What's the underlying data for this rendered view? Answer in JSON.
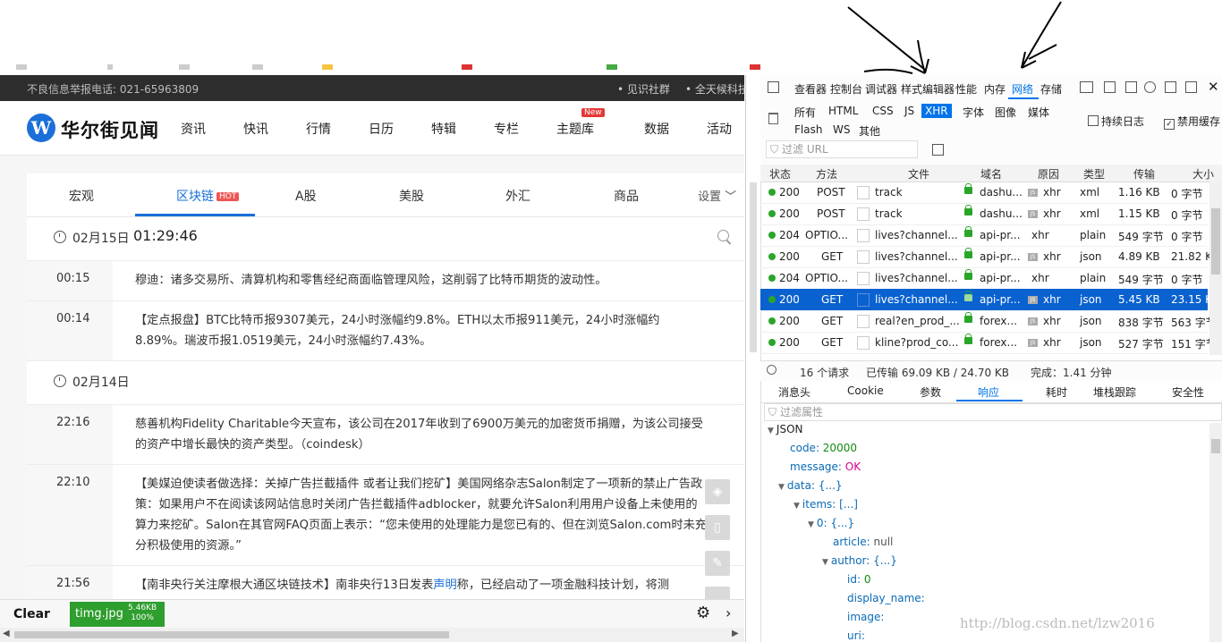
{
  "website": {
    "topbar": {
      "report": "不良信息举报电话: 021-65963809",
      "link1": "• 见识社群",
      "link2": "• 全天候科技"
    },
    "logo": {
      "mark": "W",
      "name": "华尔街见闻"
    },
    "nav": [
      "资讯",
      "快讯",
      "行情",
      "日历",
      "特辑",
      "专栏",
      "主题库",
      "数据",
      "活动"
    ],
    "nav_badge": "New",
    "tabs": [
      "宏观",
      "区块链",
      "A股",
      "美股",
      "外汇",
      "商品"
    ],
    "active_tab": "区块链",
    "hot_badge": "HOT",
    "settings_label": "设置 ﹀",
    "day1": {
      "date": "02月15日",
      "time": "01:29:46"
    },
    "day2": {
      "date": "02月14日"
    },
    "news": [
      {
        "time": "00:15",
        "text": "穆迪：诸多交易所、清算机构和零售经纪商面临管理风险，这削弱了比特币期货的波动性。"
      },
      {
        "time": "00:14",
        "text": "【定点报盘】BTC比特币报9307美元，24小时涨幅约9.8%。ETH以太币报911美元，24小时涨幅约8.89%。瑞波币报1.0519美元，24小时涨幅约7.43%。"
      },
      {
        "time": "22:16",
        "text": "慈善机构Fidelity Charitable今天宣布，该公司在2017年收到了6900万美元的加密货币捐赠，为该公司接受的资产中增长最快的资产类型。（coindesk）"
      },
      {
        "time": "22:10",
        "text": "【美媒迫使读者做选择：关掉广告拦截插件 或者让我们挖矿】美国网络杂志Salon制定了一项新的禁止广告政策：如果用户不在阅读该网站信息时关闭广告拦截插件adblocker，就要允许Salon利用用户设备上未使用的算力来挖矿。Salon在其官网FAQ页面上表示：“您未使用的处理能力是您已有的、但在浏览Salon.com时未充分积极使用的资源。”"
      },
      {
        "time": "21:56",
        "text_a": "【南非央行关注摩根大通区块链技术】南非央行13日发表",
        "text_link": "声明",
        "text_b": "称，已经启动了一项金融科技计划，将测"
      }
    ]
  },
  "download_bar": {
    "clear": "Clear",
    "file_name": "timg.jpg",
    "file_size": "5.46KB",
    "file_pct": "100%"
  },
  "devtools": {
    "toolbar_tabs": [
      "查看器",
      "控制台",
      "调试器",
      "样式编辑器",
      "性能",
      "内存",
      "网络",
      "存储"
    ],
    "active_toolbar_tab": "网络",
    "filter_buttons_row1": [
      "所有",
      "HTML",
      "CSS",
      "JS",
      "XHR",
      "字体",
      "图像",
      "媒体"
    ],
    "filter_buttons_row2": [
      "Flash",
      "WS",
      "其他"
    ],
    "active_filter": "XHR",
    "persist_log": "持续日志",
    "disable_cache": "禁用缓存",
    "url_filter_placeholder": "过滤 URL",
    "columns": [
      "状态",
      "方法",
      "文件",
      "域名",
      "原因",
      "类型",
      "传输",
      "大小"
    ],
    "requests": [
      {
        "status": "200",
        "method": "POST",
        "file": "track",
        "domain": "dashu...",
        "cause": "xhr",
        "type": "xml",
        "transferred": "1.16 KB",
        "size": "0 字节",
        "lock": true,
        "js": true
      },
      {
        "status": "200",
        "method": "POST",
        "file": "track",
        "domain": "dashu...",
        "cause": "xhr",
        "type": "xml",
        "transferred": "1.15 KB",
        "size": "0 字节",
        "lock": true,
        "js": true
      },
      {
        "status": "204",
        "method": "OPTIO...",
        "file": "lives?channel...",
        "domain": "api-pr...",
        "cause": "xhr",
        "type": "plain",
        "transferred": "549 字节",
        "size": "0 字节",
        "lock": true,
        "js": false
      },
      {
        "status": "200",
        "method": "GET",
        "file": "lives?channel...",
        "domain": "api-pr...",
        "cause": "xhr",
        "type": "json",
        "transferred": "4.89 KB",
        "size": "21.82 KB",
        "lock": true,
        "js": true
      },
      {
        "status": "204",
        "method": "OPTIO...",
        "file": "lives?channel...",
        "domain": "api-pr...",
        "cause": "xhr",
        "type": "plain",
        "transferred": "549 字节",
        "size": "0 字节",
        "lock": true,
        "js": false
      },
      {
        "status": "200",
        "method": "GET",
        "file": "lives?channel...",
        "domain": "api-pr...",
        "cause": "xhr",
        "type": "json",
        "transferred": "5.45 KB",
        "size": "23.15 KB",
        "lock": true,
        "js": true,
        "selected": true
      },
      {
        "status": "200",
        "method": "GET",
        "file": "real?en_prod_...",
        "domain": "forex...",
        "cause": "xhr",
        "type": "json",
        "transferred": "838 字节",
        "size": "563 字节",
        "lock": true,
        "js": true
      },
      {
        "status": "200",
        "method": "GET",
        "file": "kline?prod_co...",
        "domain": "forex...",
        "cause": "xhr",
        "type": "json",
        "transferred": "527 字节",
        "size": "151 字节",
        "lock": true,
        "js": true
      }
    ],
    "status_bar": {
      "count": "16 个请求",
      "transferred": "已传输 69.09 KB / 24.70 KB",
      "finish": "完成：1.41 分钟"
    },
    "detail_tabs": [
      "消息头",
      "Cookie",
      "参数",
      "响应",
      "耗时",
      "堆栈跟踪",
      "安全性"
    ],
    "active_detail_tab": "响应",
    "prop_filter_placeholder": "过滤属性",
    "json_lines": [
      {
        "k": "JSON",
        "v": "",
        "vt": "",
        "tw": "▼"
      },
      {
        "k": "code",
        "v": "20000",
        "vt": "vnum",
        "tw": ""
      },
      {
        "k": "message",
        "v": "OK",
        "vt": "vstr",
        "tw": ""
      },
      {
        "k": "data",
        "v": "{...}",
        "vt": "k",
        "tw": "▼"
      },
      {
        "k": "items",
        "v": "[...]",
        "vt": "k",
        "tw": "▼"
      },
      {
        "k": "0",
        "v": "{...}",
        "vt": "k",
        "tw": "▼"
      },
      {
        "k": "article",
        "v": "null",
        "vt": "vnull",
        "tw": ""
      },
      {
        "k": "author",
        "v": "{...}",
        "vt": "k",
        "tw": "▼"
      },
      {
        "k": "id",
        "v": "0",
        "vt": "vnum",
        "tw": ""
      },
      {
        "k": "display_name",
        "v": "",
        "vt": "",
        "tw": ""
      },
      {
        "k": "image",
        "v": "",
        "vt": "",
        "tw": ""
      },
      {
        "k": "uri",
        "v": "",
        "vt": "",
        "tw": ""
      }
    ]
  },
  "watermark": "http://blog.csdn.net/lzw2016"
}
